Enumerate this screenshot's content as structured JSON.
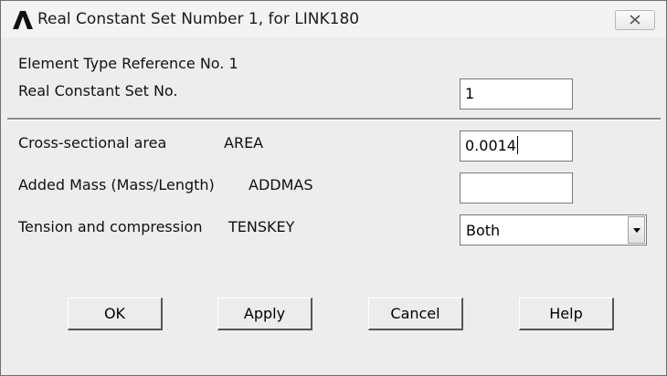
{
  "window": {
    "title": "Real Constant Set Number 1, for LINK180",
    "app_icon": "ansys-lambda-icon",
    "close_icon": "close-icon"
  },
  "header": {
    "element_type_ref": "Element Type Reference No. 1",
    "real_constant_label": "Real Constant Set No.",
    "real_constant_value": "1"
  },
  "fields": {
    "area_label": "Cross-sectional area",
    "area_key": "AREA",
    "area_value": "0.0014",
    "addmas_label": "Added Mass (Mass/Length)",
    "addmas_key": "ADDMAS",
    "addmas_value": "",
    "tenskey_label": "Tension and compression",
    "tenskey_key": "TENSKEY",
    "tenskey_value": "Both"
  },
  "buttons": {
    "ok": "OK",
    "apply": "Apply",
    "cancel": "Cancel",
    "help": "Help"
  }
}
